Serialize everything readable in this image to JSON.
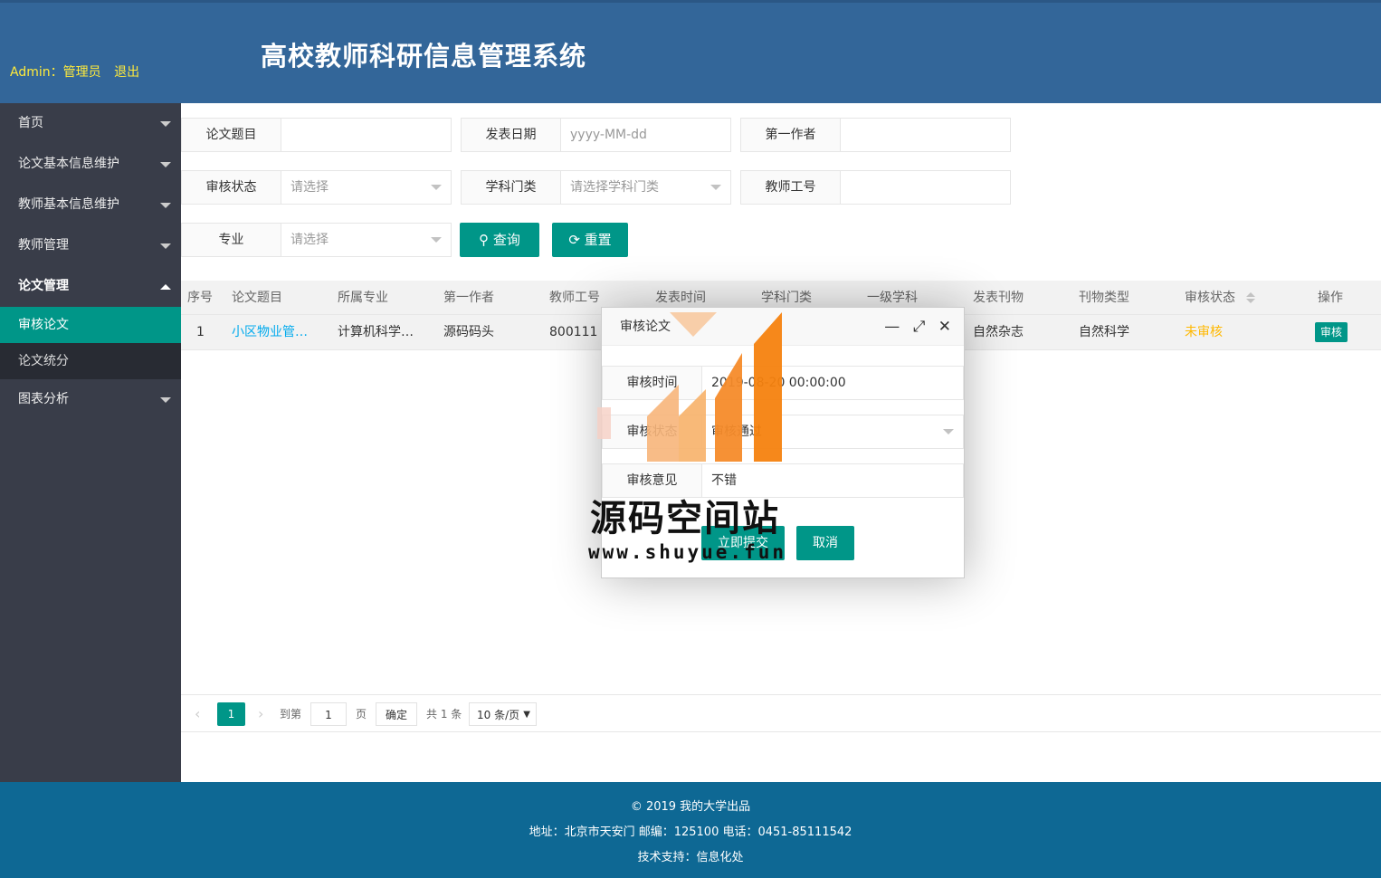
{
  "header": {
    "title": "高校教师科研信息管理系统",
    "user_label": "Admin：管理员",
    "logout": "退出"
  },
  "sidebar": {
    "items": [
      {
        "label": "首页"
      },
      {
        "label": "论文基本信息维护"
      },
      {
        "label": "教师基本信息维护"
      },
      {
        "label": "教师管理"
      },
      {
        "label": "论文管理"
      },
      {
        "label": "图表分析"
      }
    ],
    "sub_items": [
      {
        "label": "审核论文"
      },
      {
        "label": "论文统分"
      }
    ]
  },
  "filters": {
    "title": {
      "label": "论文题目",
      "value": ""
    },
    "date": {
      "label": "发表日期",
      "placeholder": "yyyy-MM-dd"
    },
    "first_author": {
      "label": "第一作者",
      "value": ""
    },
    "status": {
      "label": "审核状态",
      "placeholder": "请选择"
    },
    "category": {
      "label": "学科门类",
      "placeholder": "请选择学科门类"
    },
    "teacher_id": {
      "label": "教师工号",
      "value": ""
    },
    "major": {
      "label": "专业",
      "placeholder": "请选择"
    },
    "query_btn": "查询",
    "reset_btn": "重置"
  },
  "table": {
    "columns": [
      "序号",
      "论文题目",
      "所属专业",
      "第一作者",
      "教师工号",
      "发表时间",
      "学科门类",
      "一级学科",
      "发表刊物",
      "刊物类型",
      "审核状态",
      "操作"
    ],
    "rows": [
      {
        "index": "1",
        "title": "小区物业管理系统",
        "major": "计算机科学与技术",
        "author": "源码码头",
        "teacher_id": "800111",
        "journal": "自然杂志",
        "journal_type": "自然科学",
        "status": "未审核",
        "action": "审核"
      }
    ]
  },
  "pager": {
    "current": "1",
    "goto": "到第",
    "page_input": "1",
    "page_unit": "页",
    "confirm": "确定",
    "total": "共 1 条",
    "per_page": "10 条/页"
  },
  "modal": {
    "title": "审核论文",
    "time_label": "审核时间",
    "time_value": "2019-08-20 00:00:00",
    "status_label": "审核状态",
    "status_value": "审核通过",
    "opinion_label": "审核意见",
    "opinion_value": "不错",
    "submit": "立即提交",
    "cancel": "取消"
  },
  "footer": {
    "line1": "© 2019 我的大学出品",
    "line2": "地址：北京市天安门 邮编：125100 电话：0451-85111542",
    "line3": "技术支持：信息化处"
  },
  "watermark": {
    "brand": "源码空间站",
    "site": "www.shuyue.fun"
  },
  "colors": {
    "header": "#336699",
    "sidebar": "#393d49",
    "accent": "#009688",
    "footer": "#0e6894"
  }
}
